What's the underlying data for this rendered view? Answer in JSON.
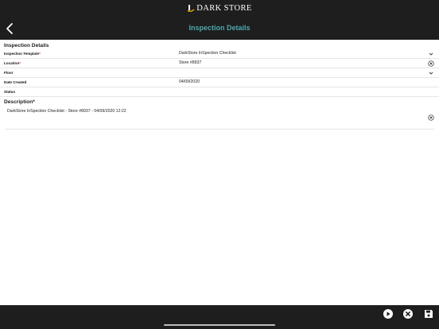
{
  "header": {
    "logo_text": "DARK STORE",
    "title": "Inspection Details",
    "back_icon": "chevron-left-icon"
  },
  "details": {
    "section_title": "Inspection Details",
    "fields": [
      {
        "label": "Inspection Template",
        "required": true,
        "value": "DarkStore InSpection Checklist",
        "icon": "chevron-down-icon"
      },
      {
        "label": "Location",
        "required": true,
        "value": "Store #8937",
        "icon": "clear-circle-icon"
      },
      {
        "label": "Floor",
        "required": false,
        "value": "",
        "icon": "chevron-down-icon"
      },
      {
        "label": "Date Created",
        "required": false,
        "value": "04/09/2020",
        "icon": ""
      },
      {
        "label": "Status",
        "required": false,
        "value": "",
        "icon": ""
      }
    ]
  },
  "description": {
    "title": "Description",
    "required": true,
    "text": "DarkStore InSpection Checklist - Store #8937 - 04/09/2020 12:22",
    "icon": "clear-circle-icon"
  },
  "toolbar": {
    "actions": [
      {
        "name": "play",
        "icon": "play-circle-icon"
      },
      {
        "name": "cancel",
        "icon": "close-circle-icon"
      },
      {
        "name": "save",
        "icon": "save-icon"
      }
    ]
  },
  "colors": {
    "bar_background": "#1e1e1e",
    "title_accent": "#4ea8ad",
    "required_marker": "#c0392b",
    "logo_gold": "#e6b800"
  }
}
